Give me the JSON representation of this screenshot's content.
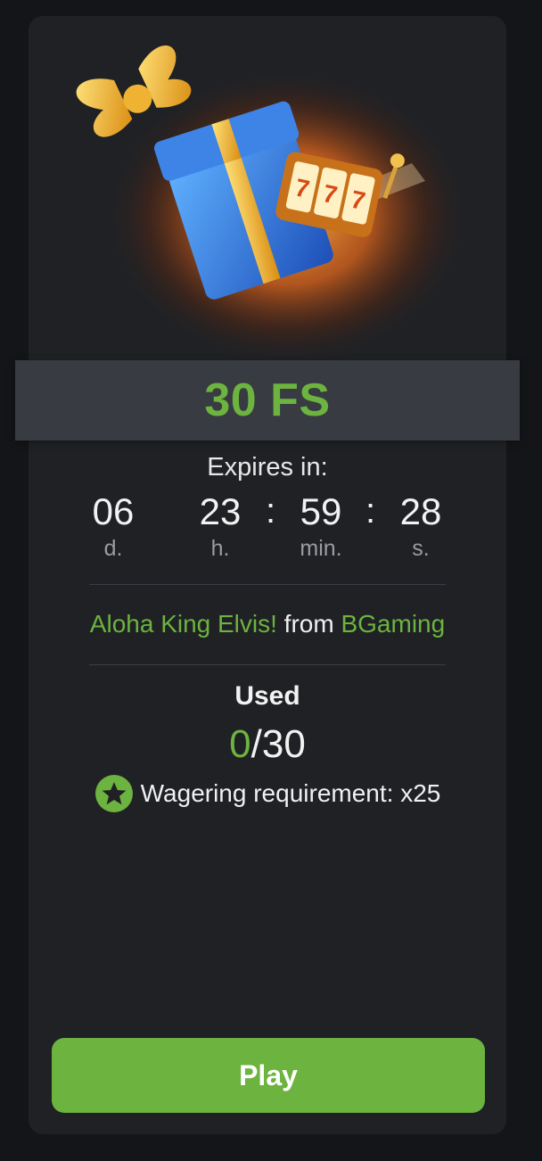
{
  "bonus": {
    "amount_label": "30 FS"
  },
  "timer": {
    "label": "Expires in:",
    "days": "06",
    "days_unit": "d.",
    "hours": "23",
    "hours_unit": "h.",
    "minutes": "59",
    "minutes_unit": "min.",
    "seconds": "28",
    "seconds_unit": "s.",
    "separator": ":"
  },
  "game": {
    "name": "Aloha King Elvis!",
    "connector": " from ",
    "provider": "BGaming"
  },
  "usage": {
    "label": "Used",
    "used": "0",
    "total": "/30"
  },
  "wagering": {
    "label": "Wagering requirement: x25",
    "icon": "star-badge-icon"
  },
  "actions": {
    "play_label": "Play"
  },
  "colors": {
    "accent": "#6cb33f",
    "card": "#1f2125",
    "banner": "#383b41",
    "background": "#141518"
  }
}
